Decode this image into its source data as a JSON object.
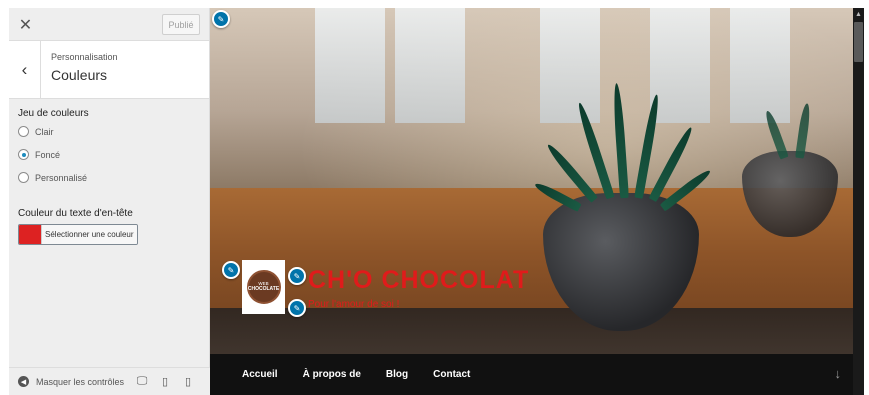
{
  "toolbar": {
    "close_icon": "close-icon",
    "publish_label": "Publié"
  },
  "section": {
    "breadcrumb": "Personnalisation",
    "title": "Couleurs",
    "back_icon": "chevron-left-icon"
  },
  "color_scheme": {
    "label": "Jeu de couleurs",
    "options": [
      {
        "label": "Clair",
        "checked": false
      },
      {
        "label": "Foncé",
        "checked": true
      },
      {
        "label": "Personnalisé",
        "checked": false
      }
    ]
  },
  "header_text_color": {
    "label": "Couleur du texte d'en-tête",
    "button_label": "Sélectionner une couleur",
    "value": "#dd2222"
  },
  "footer": {
    "hide_controls_label": "Masquer les contrôles",
    "devices": [
      "desktop-icon",
      "tablet-icon",
      "mobile-icon"
    ]
  },
  "preview": {
    "site_title": "CH'O CHOCOLAT",
    "tagline": "Pour l'amour de soi !",
    "logo": {
      "line1": "WEB",
      "line2": "CHOCOLATE"
    },
    "title_color": "#e01b1b",
    "nav": [
      "Accueil",
      "À propos de",
      "Blog",
      "Contact"
    ],
    "scroll_icon": "arrow-down-icon"
  },
  "colors": {
    "accent": "#0073aa",
    "nav_bg": "#111111"
  }
}
